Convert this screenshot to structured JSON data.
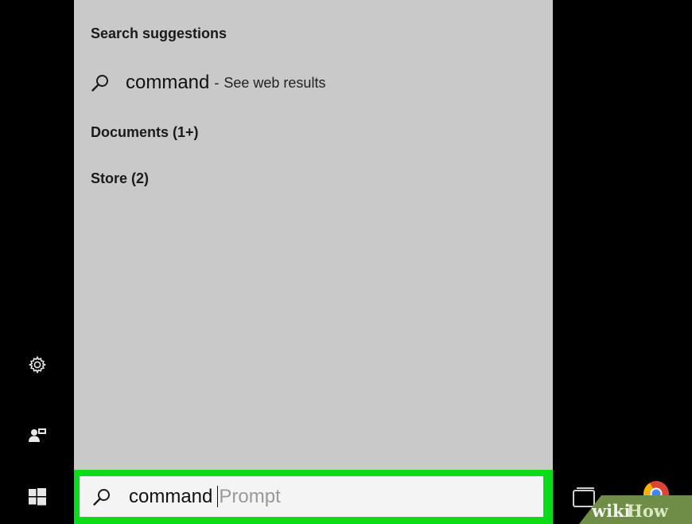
{
  "start_menu": {
    "rail": {
      "settings_icon": "gear-icon",
      "user_icon": "user-icon",
      "start_icon": "windows-logo-icon"
    },
    "search_panel": {
      "suggestions_header": "Search suggestions",
      "suggestion": {
        "term": "command",
        "separator": "-",
        "hint": "See web results"
      },
      "documents_label": "Documents (1+)",
      "store_label": "Store (2)"
    },
    "search_bar": {
      "typed": "command",
      "autocomplete": "Prompt",
      "highlight_color": "#0bdc17"
    }
  },
  "taskbar": {
    "task_view_icon": "task-view-icon",
    "chrome_icon": "chrome-icon"
  },
  "watermark": {
    "part1": "wiki",
    "part2": "How"
  }
}
